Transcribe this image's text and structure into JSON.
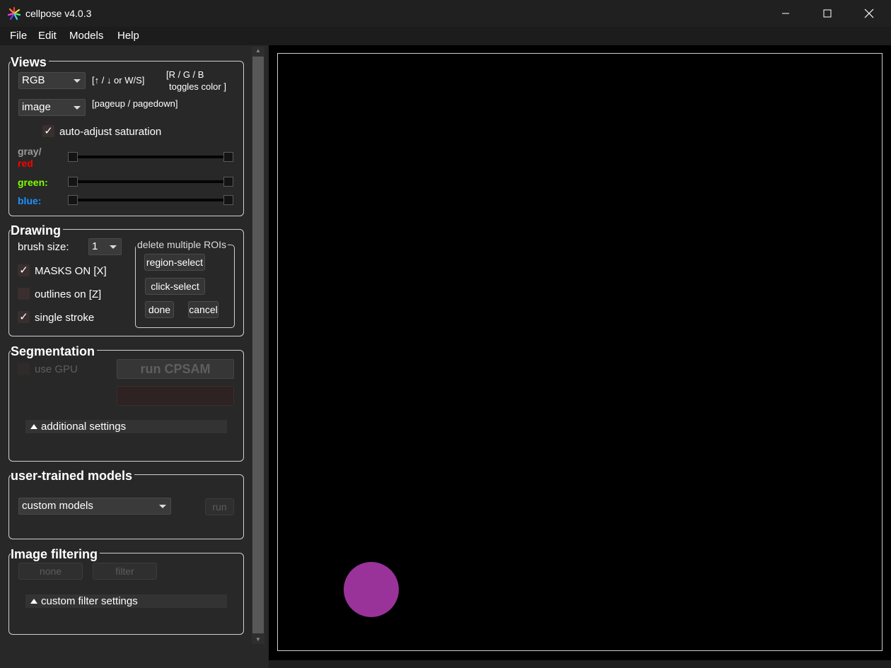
{
  "window": {
    "title": "cellpose v4.0.3"
  },
  "menu": {
    "file": "File",
    "edit": "Edit",
    "models": "Models",
    "help": "Help"
  },
  "views": {
    "title": "Views",
    "color_mode": "RGB",
    "color_hint": "[↑ / ↓ or W/S]",
    "toggle_hint_1": "[R / G / B",
    "toggle_hint_2": "toggles color ]",
    "view_mode": "image",
    "page_hint": "[pageup / pagedown]",
    "auto_adjust_label": "auto-adjust saturation",
    "auto_adjust_checked": true,
    "check_mark": "✓",
    "gray_label": "gray/",
    "red_label": "red",
    "green_label": "green:",
    "blue_label": "blue:"
  },
  "drawing": {
    "title": "Drawing",
    "brush_label": "brush size:",
    "brush_value": "1",
    "masks_label": "MASKS ON [X]",
    "outlines_label": "outlines on [Z]",
    "single_stroke_label": "single stroke",
    "roi_group_title": "delete multiple ROIs",
    "region_select": "region-select",
    "click_select": "click-select",
    "done": "done",
    "cancel": "cancel"
  },
  "segmentation": {
    "title": "Segmentation",
    "gpu_label": "use GPU",
    "run_label": "run CPSAM",
    "additional_settings": "additional settings"
  },
  "user_models": {
    "title": "user-trained models",
    "dropdown": "custom models",
    "run": "run"
  },
  "filtering": {
    "title": "Image filtering",
    "none": "none",
    "filter": "filter",
    "custom_settings": "custom filter settings"
  },
  "colors": {
    "red": "#ff0000",
    "green": "#7fff00",
    "blue": "#1e90ff",
    "gray": "#9a9a9a",
    "mask": "#993399"
  },
  "icons": {
    "logo": "cellpose-logo-icon",
    "minimize": "minimize-icon",
    "maximize": "maximize-icon",
    "close": "close-icon"
  }
}
